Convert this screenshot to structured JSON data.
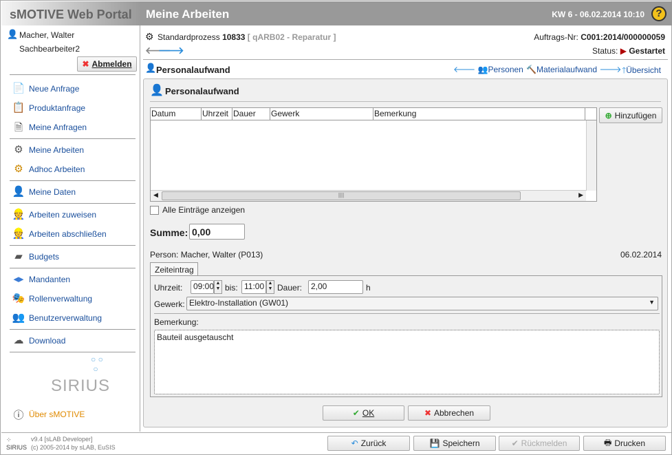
{
  "header": {
    "app_title": "sMOTIVE Web Portal",
    "page_title": "Meine Arbeiten",
    "week_date": "KW 6 - 06.02.2014 10:10",
    "help": "?"
  },
  "user": {
    "name": "Macher, Walter",
    "role": "Sachbearbeiter2",
    "logout": "Abmelden"
  },
  "sidebar": {
    "items": [
      {
        "label": "Neue Anfrage",
        "icon": "new-request-icon"
      },
      {
        "label": "Produktanfrage",
        "icon": "product-request-icon"
      },
      {
        "label": "Meine Anfragen",
        "icon": "my-requests-icon"
      },
      {
        "label": "Meine Arbeiten",
        "icon": "gears-icon"
      },
      {
        "label": "Adhoc Arbeiten",
        "icon": "adhoc-gear-icon"
      },
      {
        "label": "Meine Daten",
        "icon": "user-data-icon"
      },
      {
        "label": "Arbeiten zuweisen",
        "icon": "assign-icon"
      },
      {
        "label": "Arbeiten abschließen",
        "icon": "complete-icon"
      },
      {
        "label": "Budgets",
        "icon": "wallet-icon"
      },
      {
        "label": "Mandanten",
        "icon": "tenants-icon"
      },
      {
        "label": "Rollenverwaltung",
        "icon": "roles-icon"
      },
      {
        "label": "Benutzerverwaltung",
        "icon": "users-icon"
      },
      {
        "label": "Download",
        "icon": "download-icon"
      }
    ],
    "logo": "SIRIUS",
    "about": "Über sMOTIVE"
  },
  "process": {
    "prefix": "Standardprozess",
    "number": "10833",
    "type": "[ qARB02 - Reparatur ]",
    "order_label": "Auftrags-Nr:",
    "order_no": "C001:2014/000000059",
    "status_label": "Status:",
    "status": "Gestartet",
    "status_color": "#b00000"
  },
  "section": {
    "title": "Personalaufwand",
    "nav_persons": "Personen",
    "nav_material": "Materialaufwand",
    "nav_overview": "Übersicht"
  },
  "panel": {
    "title": "Personalaufwand",
    "add": "Hinzufügen",
    "columns": [
      "Datum",
      "Uhrzeit",
      "Dauer",
      "Gewerk",
      "Bemerkung"
    ],
    "rows": [],
    "show_all": "Alle Einträge anzeigen",
    "sum_label": "Summe:",
    "sum": "0,00",
    "person": "Person: Macher, Walter (P013)",
    "date": "06.02.2014",
    "tab": "Zeiteintrag",
    "time_label": "Uhrzeit:",
    "from": "09:00",
    "to_label": "bis:",
    "to": "11:00",
    "duration_label": "Dauer:",
    "duration": "2,00",
    "unit": "h",
    "trade_label": "Gewerk:",
    "trade": "Elektro-Installation (GW01)",
    "remark_label": "Bemerkung:",
    "remark": "Bauteil ausgetauscht",
    "ok": "OK",
    "cancel": "Abbrechen"
  },
  "footer": {
    "version": "v9.4 [sLAB Developer]",
    "copyright": "(c) 2005-2014 by sLAB, EuSIS",
    "back": "Zurück",
    "save": "Speichern",
    "feedback": "Rückmelden",
    "print": "Drucken"
  }
}
